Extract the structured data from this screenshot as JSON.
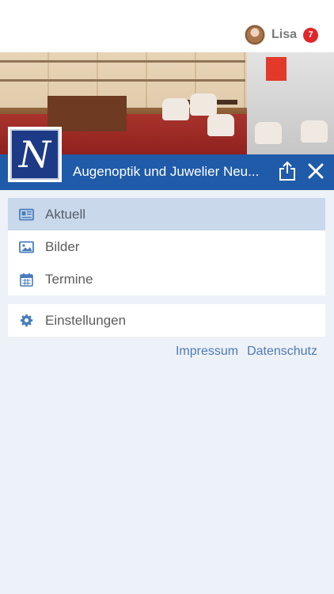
{
  "user": {
    "name": "Lisa",
    "notification_count": "7"
  },
  "header": {
    "title": "Augenoptik und Juwelier Neu...",
    "logo_letter": "N"
  },
  "menu": {
    "items": [
      {
        "label": "Aktuell",
        "icon": "newspaper-icon",
        "active": true
      },
      {
        "label": "Bilder",
        "icon": "image-icon",
        "active": false
      },
      {
        "label": "Termine",
        "icon": "calendar-icon",
        "active": false
      }
    ]
  },
  "settings": {
    "label": "Einstellungen",
    "icon": "gear-icon"
  },
  "footer": {
    "impressum": "Impressum",
    "datenschutz": "Datenschutz"
  },
  "colors": {
    "primary": "#1f5ba9",
    "active_row": "#c9d8ea",
    "icon": "#4a7dbd",
    "link": "#4f7bb3",
    "badge": "#e0262b",
    "background": "#edf1f8"
  }
}
